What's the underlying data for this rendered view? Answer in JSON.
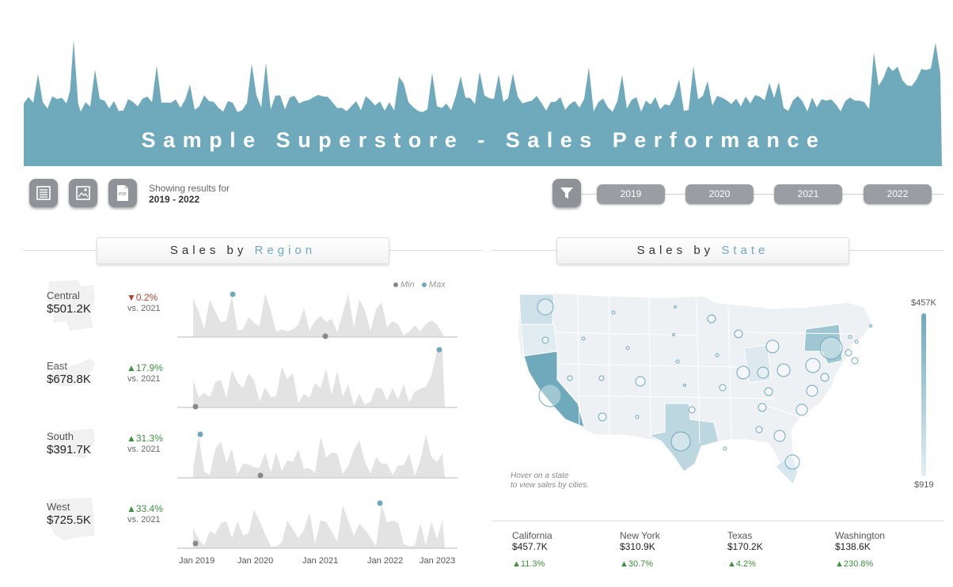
{
  "header": {
    "title": "Sample Superstore - Sales Performance",
    "accent_color": "#6fa9bc"
  },
  "toolbar": {
    "buttons": [
      {
        "icon": "list-icon"
      },
      {
        "icon": "image-icon"
      },
      {
        "icon": "pdf-icon",
        "label": "PDF"
      }
    ],
    "showing_label": "Showing results for",
    "showing_value": "2019 - 2022"
  },
  "filters": {
    "icon": "filter-icon",
    "years": [
      "2019",
      "2020",
      "2021",
      "2022"
    ]
  },
  "region_section": {
    "title_prefix": "Sales by",
    "title_accent": "Region",
    "legend": {
      "min": "Min",
      "max": "Max",
      "min_color": "#888888",
      "max_color": "#6fa9bc"
    },
    "regions": [
      {
        "name": "Central",
        "sales": "$501.2K",
        "change": "▼0.2%",
        "direction": "down",
        "vs": "vs. 2021"
      },
      {
        "name": "East",
        "sales": "$678.8K",
        "change": "▲17.9%",
        "direction": "up",
        "vs": "vs. 2021"
      },
      {
        "name": "South",
        "sales": "$391.7K",
        "change": "▲31.3%",
        "direction": "up",
        "vs": "vs. 2021"
      },
      {
        "name": "West",
        "sales": "$725.5K",
        "change": "▲33.4%",
        "direction": "up",
        "vs": "vs. 2021"
      }
    ],
    "x_ticks": [
      "Jan 2019",
      "Jan 2020",
      "Jan 2021",
      "Jan 2022",
      "Jan 2023"
    ]
  },
  "state_section": {
    "title_prefix": "Sales by",
    "title_accent": "State",
    "hint_line1": "Hover on a state",
    "hint_line2": "to view sales by cities.",
    "scale_max": "$457K",
    "scale_min": "$919",
    "top_states": [
      {
        "name": "California",
        "sales": "$457.7K",
        "change": "▲11.3%"
      },
      {
        "name": "New York",
        "sales": "$310.9K",
        "change": "▲30.7%"
      },
      {
        "name": "Texas",
        "sales": "$170.2K",
        "change": "▲4.2%"
      },
      {
        "name": "Washington",
        "sales": "$138.6K",
        "change": "▲230.8%"
      }
    ]
  }
}
